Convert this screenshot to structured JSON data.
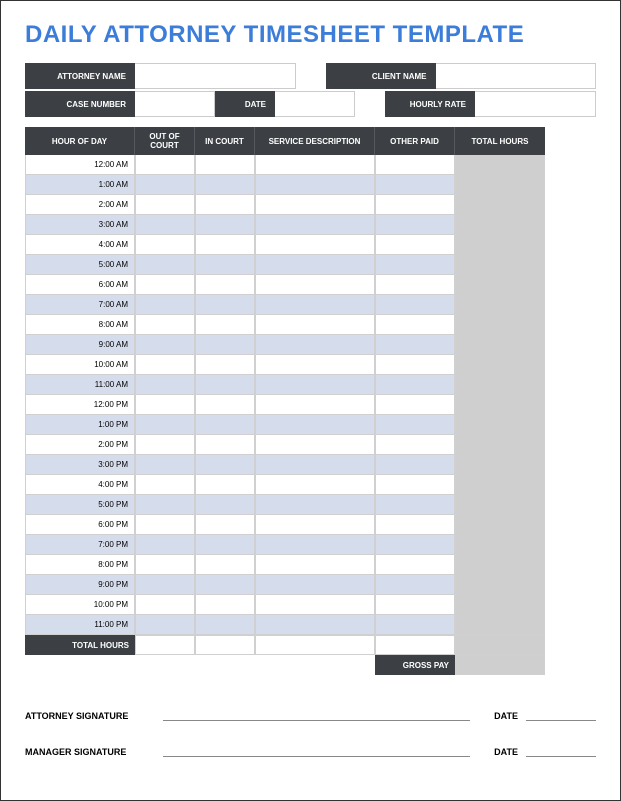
{
  "title": "DAILY ATTORNEY TIMESHEET TEMPLATE",
  "info": {
    "attorney_name_label": "ATTORNEY NAME",
    "client_name_label": "CLIENT NAME",
    "case_number_label": "CASE NUMBER",
    "date_label": "DATE",
    "hourly_rate_label": "HOURLY RATE",
    "attorney_name": "",
    "client_name": "",
    "case_number": "",
    "date": "",
    "hourly_rate": ""
  },
  "columns": {
    "hour": "HOUR OF DAY",
    "out_of_court": "OUT OF COURT",
    "in_court": "IN COURT",
    "service": "SERVICE DESCRIPTION",
    "other_paid": "OTHER PAID",
    "total_hours": "TOTAL HOURS"
  },
  "hours": [
    "12:00 AM",
    "1:00 AM",
    "2:00 AM",
    "3:00 AM",
    "4:00 AM",
    "5:00 AM",
    "6:00 AM",
    "7:00 AM",
    "8:00 AM",
    "9:00 AM",
    "10:00 AM",
    "11:00 AM",
    "12:00 PM",
    "1:00 PM",
    "2:00 PM",
    "3:00 PM",
    "4:00 PM",
    "5:00 PM",
    "6:00 PM",
    "7:00 PM",
    "8:00 PM",
    "9:00 PM",
    "10:00 PM",
    "11:00 PM"
  ],
  "totals": {
    "total_hours_label": "TOTAL HOURS",
    "gross_pay_label": "GROSS PAY",
    "total_hours": "",
    "gross_pay": ""
  },
  "signatures": {
    "attorney_label": "ATTORNEY SIGNATURE",
    "manager_label": "MANAGER SIGNATURE",
    "date_label": "DATE"
  }
}
